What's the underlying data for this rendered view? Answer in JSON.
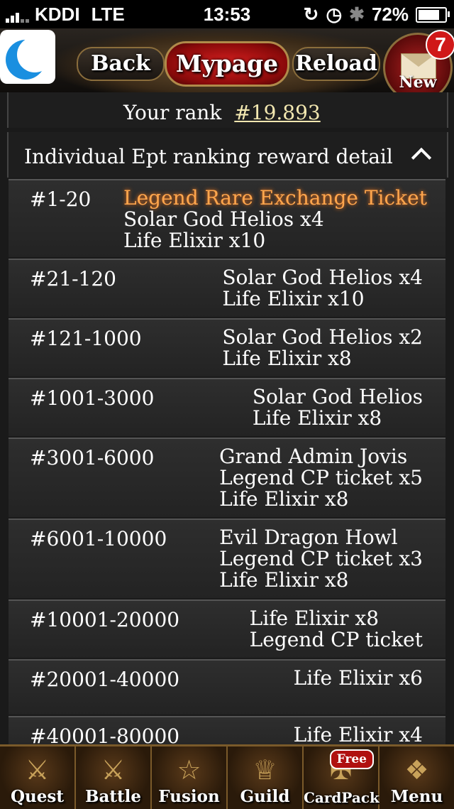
{
  "status_bar": {
    "carrier": "KDDI",
    "network": "LTE",
    "time": "13:53",
    "battery": "72%"
  },
  "nav": {
    "back": "Back",
    "mypage": "Mypage",
    "reload": "Reload",
    "mail_label": "New",
    "mail_badge": "7"
  },
  "rank": {
    "label": "Your rank",
    "value": "#19.893"
  },
  "section": {
    "title": "Individual Ept ranking reward detail"
  },
  "rows": [
    {
      "rank": "#1-20",
      "rewards": [
        "Legend Rare Exchange Ticket",
        "Solar God Helios x4",
        "Life Elixir x10"
      ]
    },
    {
      "rank": "#21-120",
      "rewards": [
        "Solar God Helios x4",
        "Life Elixir x10"
      ]
    },
    {
      "rank": "#121-1000",
      "rewards": [
        "Solar God Helios x2",
        "Life Elixir x8"
      ]
    },
    {
      "rank": "#1001-3000",
      "rewards": [
        "Solar God Helios",
        "Life Elixir x8"
      ]
    },
    {
      "rank": "#3001-6000",
      "rewards": [
        "Grand Admin Jovis",
        "Legend CP ticket x5",
        "Life Elixir x8"
      ]
    },
    {
      "rank": "#6001-10000",
      "rewards": [
        "Evil Dragon Howl",
        "Legend CP ticket x3",
        "Life Elixir x8"
      ]
    },
    {
      "rank": "#10001-20000",
      "rewards": [
        "Life Elixir x8",
        "Legend CP ticket"
      ]
    },
    {
      "rank": "#20001-40000",
      "rewards": [
        "Life Elixir x6"
      ]
    },
    {
      "rank": "#40001-80000",
      "rewards": [
        "Life Elixir x4"
      ]
    }
  ],
  "tabs": [
    {
      "label": "Quest",
      "icon": "lion-crest-icon"
    },
    {
      "label": "Battle",
      "icon": "crossed-swords-icon"
    },
    {
      "label": "Fusion",
      "icon": "pentagram-icon"
    },
    {
      "label": "Guild",
      "icon": "crown-icon"
    },
    {
      "label": "CardPack",
      "icon": "cards-icon",
      "badge": "Free"
    },
    {
      "label": "Menu",
      "icon": "dragon-icon"
    }
  ],
  "colors": {
    "highlight": "#ffa64d",
    "rank_link": "#f2e7b0",
    "mypage_red": "#d92020"
  }
}
